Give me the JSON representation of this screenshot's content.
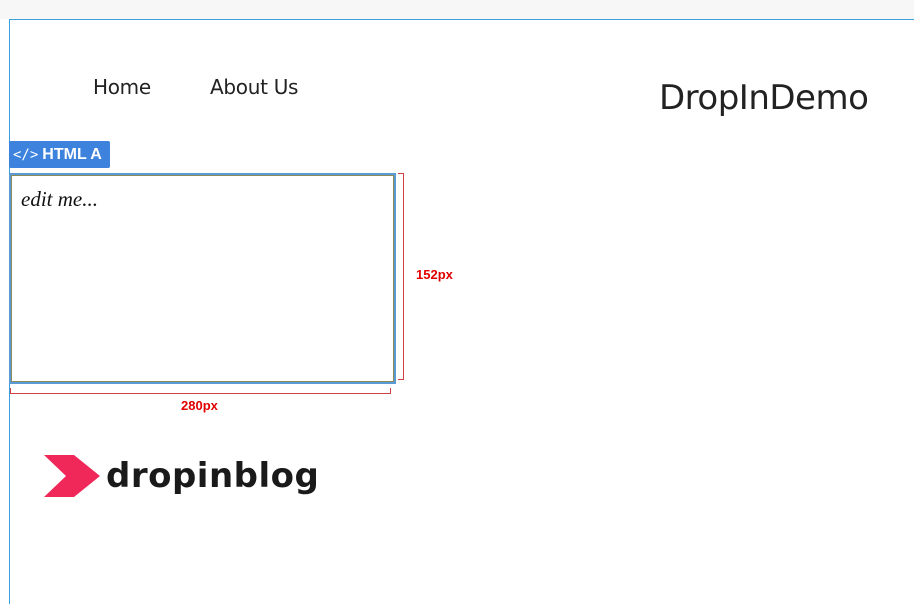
{
  "nav": {
    "home_label": "Home",
    "about_label": "About Us"
  },
  "site": {
    "title": "DropInDemo"
  },
  "block": {
    "tag_label": "HTML A",
    "editor_placeholder": "edit me..."
  },
  "dimensions": {
    "height_label": "152px",
    "width_label": "280px"
  },
  "logo": {
    "text": "dropinblog",
    "accent_color": "#f0285a"
  },
  "colors": {
    "block_tag": "#3d82dc",
    "canvas_border": "#3aa0dd",
    "dimension": "#e00000"
  }
}
